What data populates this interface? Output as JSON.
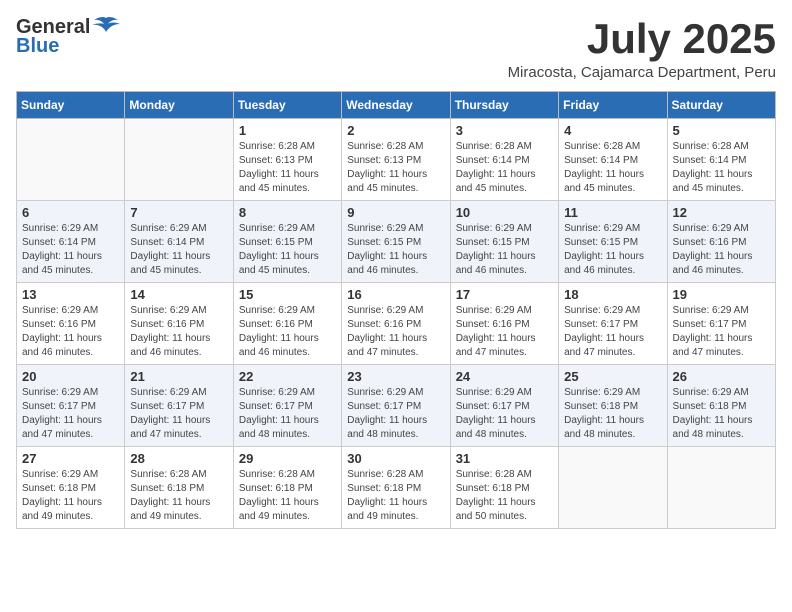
{
  "header": {
    "logo_general": "General",
    "logo_blue": "Blue",
    "month_year": "July 2025",
    "location": "Miracosta, Cajamarca Department, Peru"
  },
  "weekdays": [
    "Sunday",
    "Monday",
    "Tuesday",
    "Wednesday",
    "Thursday",
    "Friday",
    "Saturday"
  ],
  "weeks": [
    [
      {
        "day": "",
        "sunrise": "",
        "sunset": "",
        "daylight": ""
      },
      {
        "day": "",
        "sunrise": "",
        "sunset": "",
        "daylight": ""
      },
      {
        "day": "1",
        "sunrise": "Sunrise: 6:28 AM",
        "sunset": "Sunset: 6:13 PM",
        "daylight": "Daylight: 11 hours and 45 minutes."
      },
      {
        "day": "2",
        "sunrise": "Sunrise: 6:28 AM",
        "sunset": "Sunset: 6:13 PM",
        "daylight": "Daylight: 11 hours and 45 minutes."
      },
      {
        "day": "3",
        "sunrise": "Sunrise: 6:28 AM",
        "sunset": "Sunset: 6:14 PM",
        "daylight": "Daylight: 11 hours and 45 minutes."
      },
      {
        "day": "4",
        "sunrise": "Sunrise: 6:28 AM",
        "sunset": "Sunset: 6:14 PM",
        "daylight": "Daylight: 11 hours and 45 minutes."
      },
      {
        "day": "5",
        "sunrise": "Sunrise: 6:28 AM",
        "sunset": "Sunset: 6:14 PM",
        "daylight": "Daylight: 11 hours and 45 minutes."
      }
    ],
    [
      {
        "day": "6",
        "sunrise": "Sunrise: 6:29 AM",
        "sunset": "Sunset: 6:14 PM",
        "daylight": "Daylight: 11 hours and 45 minutes."
      },
      {
        "day": "7",
        "sunrise": "Sunrise: 6:29 AM",
        "sunset": "Sunset: 6:14 PM",
        "daylight": "Daylight: 11 hours and 45 minutes."
      },
      {
        "day": "8",
        "sunrise": "Sunrise: 6:29 AM",
        "sunset": "Sunset: 6:15 PM",
        "daylight": "Daylight: 11 hours and 45 minutes."
      },
      {
        "day": "9",
        "sunrise": "Sunrise: 6:29 AM",
        "sunset": "Sunset: 6:15 PM",
        "daylight": "Daylight: 11 hours and 46 minutes."
      },
      {
        "day": "10",
        "sunrise": "Sunrise: 6:29 AM",
        "sunset": "Sunset: 6:15 PM",
        "daylight": "Daylight: 11 hours and 46 minutes."
      },
      {
        "day": "11",
        "sunrise": "Sunrise: 6:29 AM",
        "sunset": "Sunset: 6:15 PM",
        "daylight": "Daylight: 11 hours and 46 minutes."
      },
      {
        "day": "12",
        "sunrise": "Sunrise: 6:29 AM",
        "sunset": "Sunset: 6:16 PM",
        "daylight": "Daylight: 11 hours and 46 minutes."
      }
    ],
    [
      {
        "day": "13",
        "sunrise": "Sunrise: 6:29 AM",
        "sunset": "Sunset: 6:16 PM",
        "daylight": "Daylight: 11 hours and 46 minutes."
      },
      {
        "day": "14",
        "sunrise": "Sunrise: 6:29 AM",
        "sunset": "Sunset: 6:16 PM",
        "daylight": "Daylight: 11 hours and 46 minutes."
      },
      {
        "day": "15",
        "sunrise": "Sunrise: 6:29 AM",
        "sunset": "Sunset: 6:16 PM",
        "daylight": "Daylight: 11 hours and 46 minutes."
      },
      {
        "day": "16",
        "sunrise": "Sunrise: 6:29 AM",
        "sunset": "Sunset: 6:16 PM",
        "daylight": "Daylight: 11 hours and 47 minutes."
      },
      {
        "day": "17",
        "sunrise": "Sunrise: 6:29 AM",
        "sunset": "Sunset: 6:16 PM",
        "daylight": "Daylight: 11 hours and 47 minutes."
      },
      {
        "day": "18",
        "sunrise": "Sunrise: 6:29 AM",
        "sunset": "Sunset: 6:17 PM",
        "daylight": "Daylight: 11 hours and 47 minutes."
      },
      {
        "day": "19",
        "sunrise": "Sunrise: 6:29 AM",
        "sunset": "Sunset: 6:17 PM",
        "daylight": "Daylight: 11 hours and 47 minutes."
      }
    ],
    [
      {
        "day": "20",
        "sunrise": "Sunrise: 6:29 AM",
        "sunset": "Sunset: 6:17 PM",
        "daylight": "Daylight: 11 hours and 47 minutes."
      },
      {
        "day": "21",
        "sunrise": "Sunrise: 6:29 AM",
        "sunset": "Sunset: 6:17 PM",
        "daylight": "Daylight: 11 hours and 47 minutes."
      },
      {
        "day": "22",
        "sunrise": "Sunrise: 6:29 AM",
        "sunset": "Sunset: 6:17 PM",
        "daylight": "Daylight: 11 hours and 48 minutes."
      },
      {
        "day": "23",
        "sunrise": "Sunrise: 6:29 AM",
        "sunset": "Sunset: 6:17 PM",
        "daylight": "Daylight: 11 hours and 48 minutes."
      },
      {
        "day": "24",
        "sunrise": "Sunrise: 6:29 AM",
        "sunset": "Sunset: 6:17 PM",
        "daylight": "Daylight: 11 hours and 48 minutes."
      },
      {
        "day": "25",
        "sunrise": "Sunrise: 6:29 AM",
        "sunset": "Sunset: 6:18 PM",
        "daylight": "Daylight: 11 hours and 48 minutes."
      },
      {
        "day": "26",
        "sunrise": "Sunrise: 6:29 AM",
        "sunset": "Sunset: 6:18 PM",
        "daylight": "Daylight: 11 hours and 48 minutes."
      }
    ],
    [
      {
        "day": "27",
        "sunrise": "Sunrise: 6:29 AM",
        "sunset": "Sunset: 6:18 PM",
        "daylight": "Daylight: 11 hours and 49 minutes."
      },
      {
        "day": "28",
        "sunrise": "Sunrise: 6:28 AM",
        "sunset": "Sunset: 6:18 PM",
        "daylight": "Daylight: 11 hours and 49 minutes."
      },
      {
        "day": "29",
        "sunrise": "Sunrise: 6:28 AM",
        "sunset": "Sunset: 6:18 PM",
        "daylight": "Daylight: 11 hours and 49 minutes."
      },
      {
        "day": "30",
        "sunrise": "Sunrise: 6:28 AM",
        "sunset": "Sunset: 6:18 PM",
        "daylight": "Daylight: 11 hours and 49 minutes."
      },
      {
        "day": "31",
        "sunrise": "Sunrise: 6:28 AM",
        "sunset": "Sunset: 6:18 PM",
        "daylight": "Daylight: 11 hours and 50 minutes."
      },
      {
        "day": "",
        "sunrise": "",
        "sunset": "",
        "daylight": ""
      },
      {
        "day": "",
        "sunrise": "",
        "sunset": "",
        "daylight": ""
      }
    ]
  ]
}
